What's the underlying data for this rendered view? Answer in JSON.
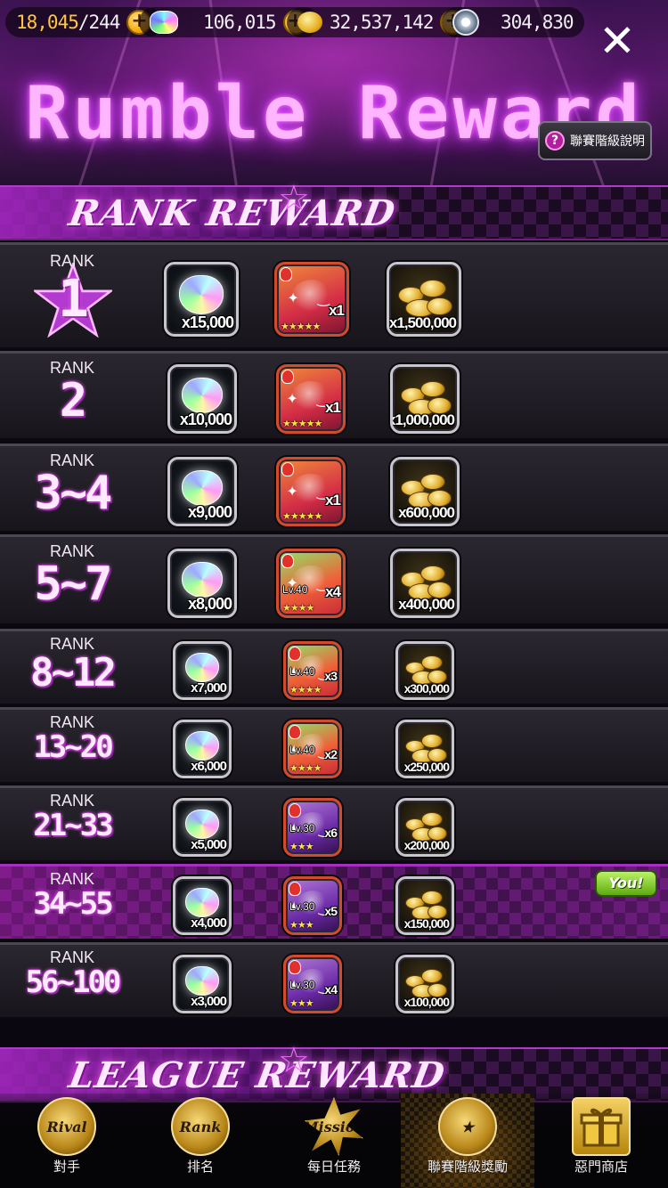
{
  "resources": {
    "stamina_current": "18,045",
    "stamina_max": "/244",
    "gems": "106,015",
    "gold": "32,537,142",
    "tokens": "304,830",
    "plus_symbol": "+"
  },
  "header": {
    "title": "Rumble Reward",
    "close_symbol": "✕",
    "help_label": "聯賽階級說明",
    "help_icon": "?"
  },
  "sections": {
    "rank_reward": "RANK REWARD",
    "league_reward": "LEAGUE REWARD"
  },
  "rank_label": "RANK",
  "you_badge": "You!",
  "rows": [
    {
      "rank": "1",
      "gems": "x15,000",
      "monster_qty": "x1",
      "monster_level": "",
      "monster_stars": "★★★★★",
      "gold": "x1,500,000"
    },
    {
      "rank": "2",
      "gems": "x10,000",
      "monster_qty": "x1",
      "monster_level": "",
      "monster_stars": "★★★★★",
      "gold": "x1,000,000"
    },
    {
      "rank": "3~4",
      "gems": "x9,000",
      "monster_qty": "x1",
      "monster_level": "",
      "monster_stars": "★★★★★",
      "gold": "x600,000"
    },
    {
      "rank": "5~7",
      "gems": "x8,000",
      "monster_qty": "x4",
      "monster_level": "Lv.40",
      "monster_stars": "★★★★",
      "gold": "x400,000"
    },
    {
      "rank": "8~12",
      "gems": "x7,000",
      "monster_qty": "x3",
      "monster_level": "Lv.40",
      "monster_stars": "★★★★",
      "gold": "x300,000"
    },
    {
      "rank": "13~20",
      "gems": "x6,000",
      "monster_qty": "x2",
      "monster_level": "Lv.40",
      "monster_stars": "★★★★",
      "gold": "x250,000"
    },
    {
      "rank": "21~33",
      "gems": "x5,000",
      "monster_qty": "x6",
      "monster_level": "Lv.30",
      "monster_stars": "★★★",
      "gold": "x200,000"
    },
    {
      "rank": "34~55",
      "gems": "x4,000",
      "monster_qty": "x5",
      "monster_level": "Lv.30",
      "monster_stars": "★★★",
      "gold": "x150,000"
    },
    {
      "rank": "56~100",
      "gems": "x3,000",
      "monster_qty": "x4",
      "monster_level": "Lv.30",
      "monster_stars": "★★★",
      "gold": "x100,000"
    }
  ],
  "current_rank_index": 7,
  "nav": [
    {
      "label": "對手",
      "icon_text": "Rival",
      "icon": "rival-icon",
      "active": false
    },
    {
      "label": "排名",
      "icon_text": "Rank",
      "icon": "rank-globe-icon",
      "active": false
    },
    {
      "label": "每日任務",
      "icon_text": "Mission",
      "icon": "mission-burst-icon",
      "active": false
    },
    {
      "label": "聯賽階級獎勵",
      "icon_text": "★",
      "icon": "league-medal-icon",
      "active": true
    },
    {
      "label": "惡門商店",
      "icon_text": "",
      "icon": "gift-box-icon",
      "active": false
    }
  ],
  "colors": {
    "accent_magenta": "#d040ff",
    "gold": "#ffc640",
    "you_green": "#7bc41c"
  }
}
